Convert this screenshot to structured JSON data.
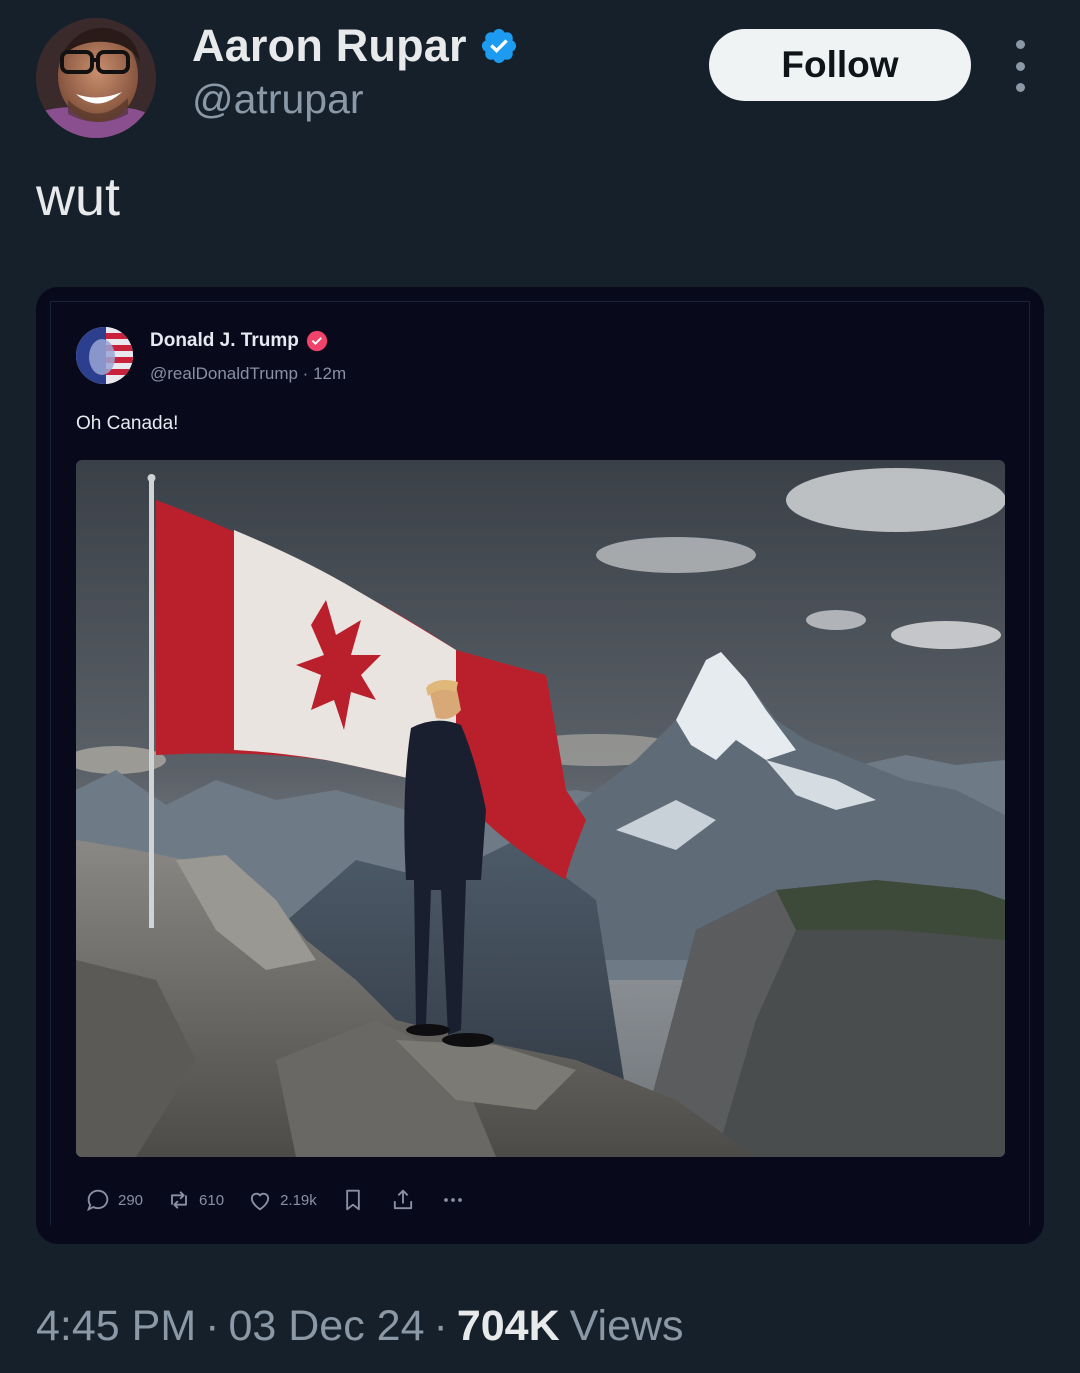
{
  "author": {
    "display_name": "Aaron Rupar",
    "handle": "@atrupar",
    "verified": true,
    "verified_color": "#1d9bf0"
  },
  "follow_label": "Follow",
  "more_icon": "more-dots-icon",
  "tweet_text": "wut",
  "quoted_post": {
    "display_name": "Donald J. Trump",
    "handle_line": "@realDonaldTrump · 12m",
    "verified_color": "#f0426b",
    "text": "Oh Canada!",
    "image": "man-in-suit-beside-canadian-flag-on-mountain",
    "actions": [
      {
        "icon": "reply-icon",
        "count": "290"
      },
      {
        "icon": "repost-icon",
        "count": "610"
      },
      {
        "icon": "like-icon",
        "count": "2.19k"
      },
      {
        "icon": "bookmark-icon",
        "count": ""
      },
      {
        "icon": "share-icon",
        "count": ""
      },
      {
        "icon": "more-icon",
        "count": ""
      }
    ]
  },
  "meta": {
    "time": "4:45 PM",
    "separator": "·",
    "date": "03 Dec 24",
    "views_count": "704K",
    "views_label": "Views"
  }
}
